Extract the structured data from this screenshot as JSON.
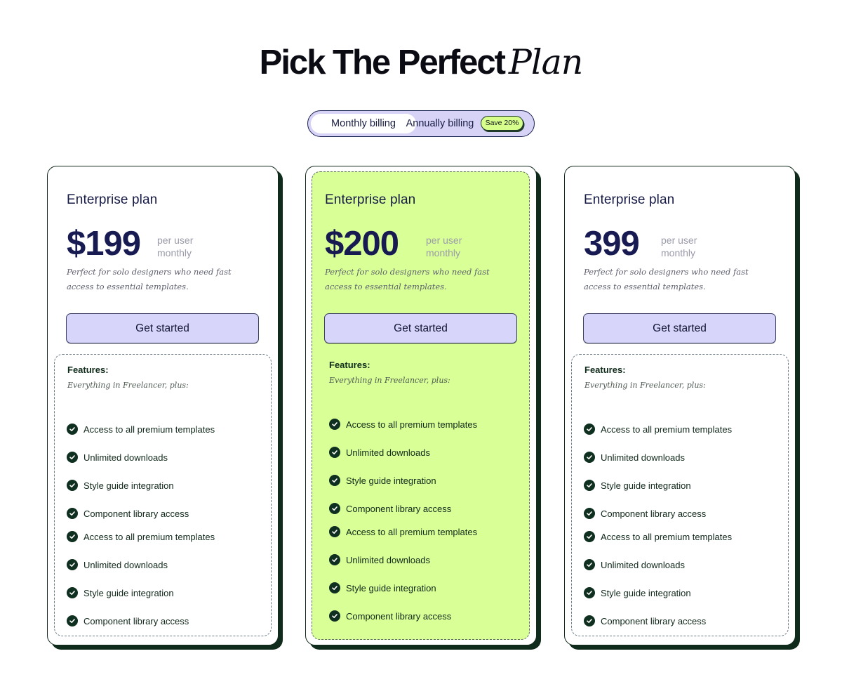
{
  "header": {
    "title_lead": "Pick The Perfect",
    "title_accent": "Plan"
  },
  "billing_toggle": {
    "monthly_label": "Monthly billing",
    "annually_label": "Annually billing",
    "save_badge": "Save 20%",
    "selected": "Monthly billing"
  },
  "colors": {
    "highlight_card": "#d9ff97",
    "button": "#d8d5fb",
    "badge": "#d6ff8c",
    "dark_green": "#0e2b1c",
    "navy": "#181a52"
  },
  "plans": [
    {
      "name": "Enterprise plan",
      "price": "$199",
      "per_line1": "per user",
      "per_line2": "monthly",
      "description": "Perfect for solo designers who need fast access to essential templates.",
      "cta": "Get started",
      "features_title": "Features:",
      "features_subtitle": "Everything in Freelancer, plus:",
      "features": [
        "Access to all premium templates",
        "Unlimited downloads",
        "Style guide integration",
        "Component library access",
        "Access to all premium templates",
        "Unlimited downloads",
        "Style guide integration",
        "Component library access"
      ]
    },
    {
      "name": "Enterprise plan",
      "price": "$200",
      "per_line1": "per user",
      "per_line2": "monthly",
      "description": "Perfect for solo designers who need fast access to essential templates.",
      "cta": "Get started",
      "features_title": "Features:",
      "features_subtitle": "Everything in Freelancer, plus:",
      "features": [
        "Access to all premium templates",
        "Unlimited downloads",
        "Style guide integration",
        "Component library access",
        "Access to all premium templates",
        "Unlimited downloads",
        "Style guide integration",
        "Component library access"
      ]
    },
    {
      "name": "Enterprise plan",
      "price": "399",
      "per_line1": "per user",
      "per_line2": "monthly",
      "description": "Perfect for solo designers who need fast access to essential templates.",
      "cta": "Get started",
      "features_title": "Features:",
      "features_subtitle": "Everything in Freelancer, plus:",
      "features": [
        "Access to all premium templates",
        "Unlimited downloads",
        "Style guide integration",
        "Component library access",
        "Access to all premium templates",
        "Unlimited downloads",
        "Style guide integration",
        "Component library access"
      ]
    }
  ]
}
